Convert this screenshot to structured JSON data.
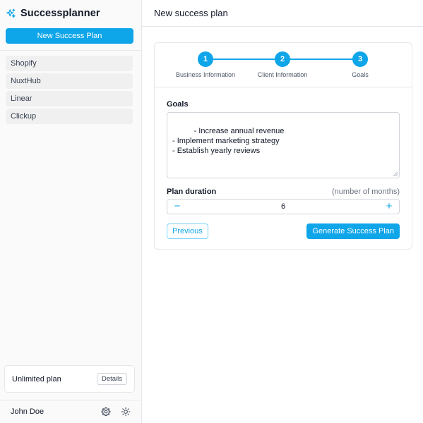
{
  "sidebar": {
    "brand": {
      "title": "Successplanner",
      "icon": "sparkles-icon"
    },
    "new_plan_label": "New Success Plan",
    "items": [
      {
        "label": "Shopify"
      },
      {
        "label": "NuxtHub"
      },
      {
        "label": "Linear"
      },
      {
        "label": "Clickup"
      }
    ],
    "plan_card": {
      "label": "Unlimited plan",
      "details_label": "Details"
    },
    "user": {
      "name": "John Doe",
      "settings_icon": "gear-icon",
      "theme_icon": "sun-icon"
    }
  },
  "header": {
    "title": "New success plan"
  },
  "stepper": {
    "steps": [
      {
        "number": "1",
        "label": "Business Information"
      },
      {
        "number": "2",
        "label": "Client Information"
      },
      {
        "number": "3",
        "label": "Goals"
      }
    ],
    "current_step": 3
  },
  "form": {
    "goals_label": "Goals",
    "goals_value": "- Increase annual revenue\n- Implement marketing strategy\n- Establish yearly reviews",
    "duration_label": "Plan duration",
    "duration_hint": "(number of months)",
    "duration_value": "6",
    "decrement_symbol": "−",
    "increment_symbol": "+",
    "previous_label": "Previous",
    "generate_label": "Generate Success Plan"
  },
  "colors": {
    "accent": "#0ea5e9",
    "border": "#e5e7eb",
    "sidebar_bg": "#fafafa"
  }
}
